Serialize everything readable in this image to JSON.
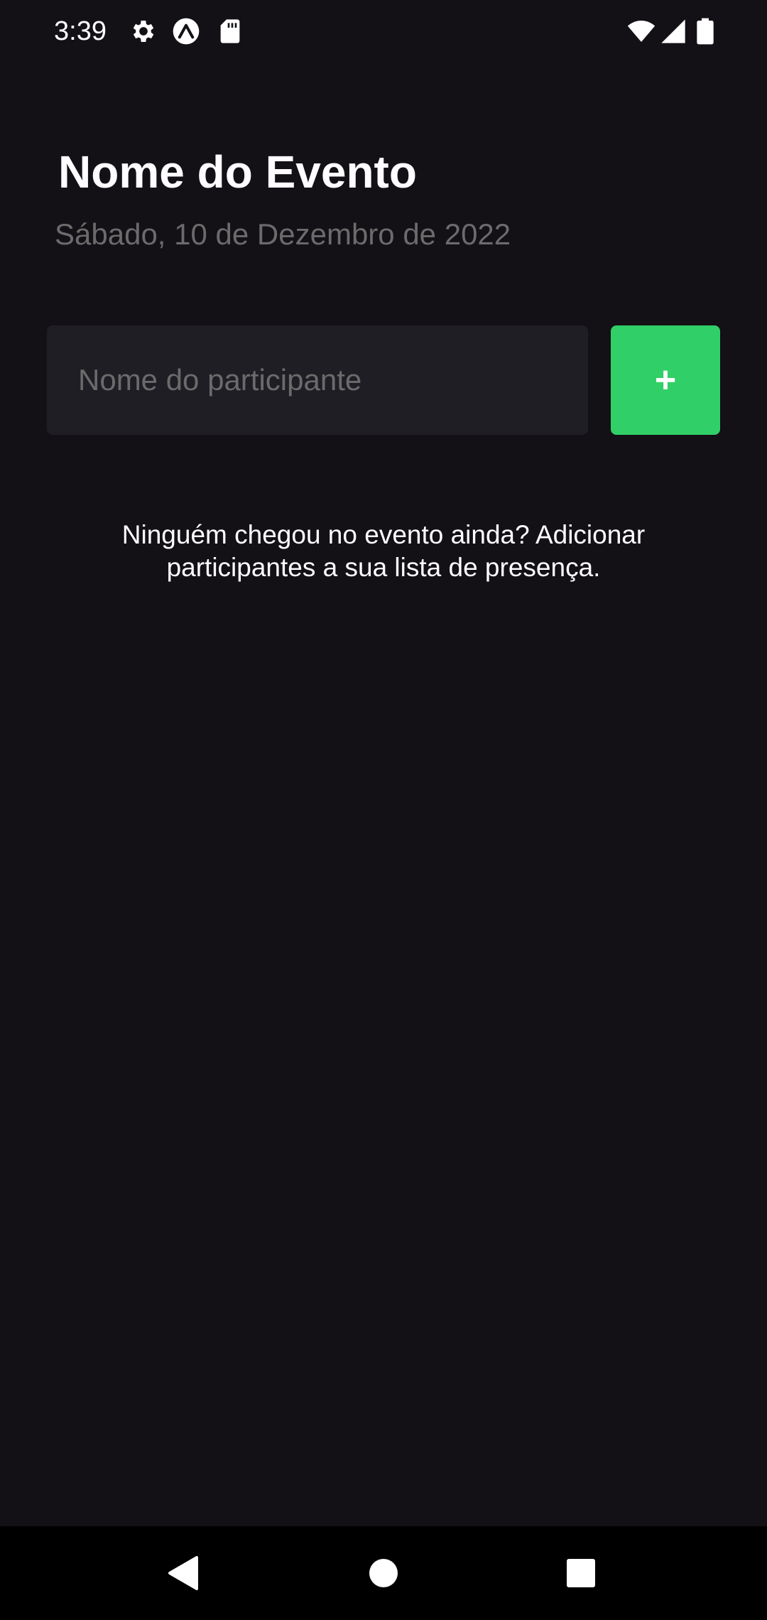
{
  "status_bar": {
    "time": "3:39",
    "left_icons": [
      "gear-icon",
      "expo-icon",
      "sd-card-icon"
    ],
    "right_icons": [
      "wifi-icon",
      "cell-signal-icon",
      "battery-icon"
    ]
  },
  "event": {
    "title": "Nome do Evento",
    "date": "Sábado, 10 de Dezembro de 2022"
  },
  "form": {
    "participant_value": "",
    "participant_placeholder": "Nome do participante",
    "add_label": "+"
  },
  "list": {
    "empty_message": "Ninguém chegou no evento ainda? Adicionar participantes a sua lista de presença."
  },
  "nav_bar": {
    "buttons": [
      "back-icon",
      "home-icon",
      "recents-icon"
    ]
  },
  "colors": {
    "background": "#131016",
    "input_background": "#1F1E25",
    "accent": "#31CF67",
    "muted_text": "#6B6B6B",
    "text": "#FDFCFE"
  }
}
